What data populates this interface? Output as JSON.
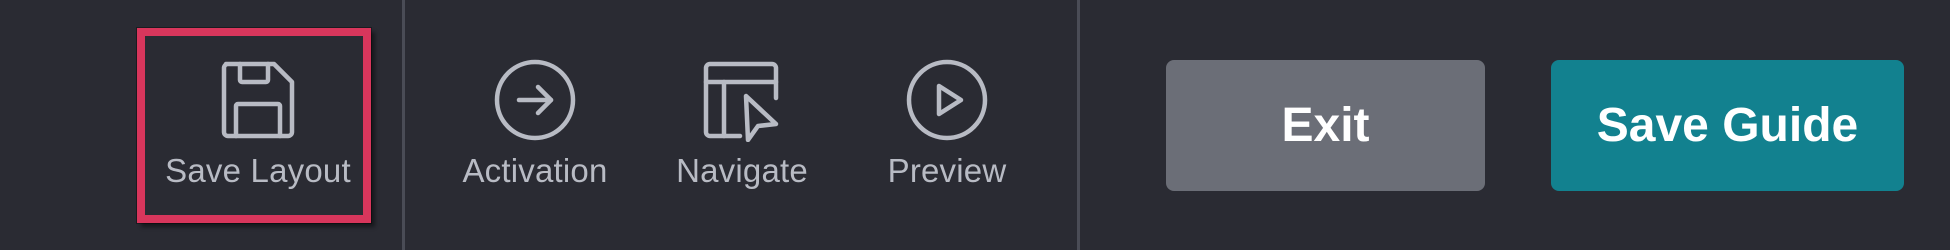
{
  "toolbar": {
    "tools": [
      {
        "label": "Save Layout",
        "icon": "floppy-disk-icon"
      },
      {
        "label": "Activation",
        "icon": "arrow-right-circle-icon"
      },
      {
        "label": "Navigate",
        "icon": "layout-pointer-icon"
      },
      {
        "label": "Preview",
        "icon": "play-circle-icon"
      }
    ],
    "exit_label": "Exit",
    "save_guide_label": "Save Guide"
  },
  "colors": {
    "background": "#2a2b33",
    "icon": "#b8bbc4",
    "highlight": "#d8365c",
    "exit_button": "#6b6e77",
    "save_guide_button": "#12818f"
  }
}
